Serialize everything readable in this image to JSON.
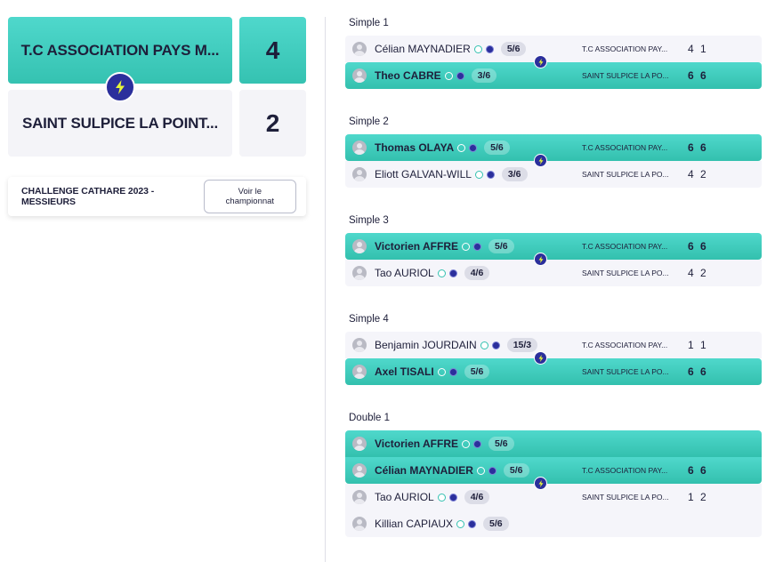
{
  "home_team": {
    "name": "T.C ASSOCIATION PAYS M...",
    "score": "4"
  },
  "away_team": {
    "name": "SAINT SULPICE LA POINT...",
    "score": "2"
  },
  "championship": {
    "title": "CHALLENGE CATHARE 2023 - MESSIEURS",
    "button_label": "Voir le championnat"
  },
  "colors": {
    "accent": "#35c2b1",
    "badge": "#2b2f9c",
    "neutral": "#f5f5fa"
  },
  "matches": [
    {
      "label": "Simple 1",
      "rows": [
        {
          "name": "Célian MAYNADIER",
          "rank": "5/6",
          "club": "T.C ASSOCIATION PAY...",
          "sets": "4 1",
          "win": false
        },
        {
          "name": "Theo CABRE",
          "rank": "3/6",
          "club": "SAINT SULPICE LA PO...",
          "sets": "6 6",
          "win": true
        }
      ]
    },
    {
      "label": "Simple 2",
      "rows": [
        {
          "name": "Thomas OLAYA",
          "rank": "5/6",
          "club": "T.C ASSOCIATION PAY...",
          "sets": "6 6",
          "win": true
        },
        {
          "name": "Eliott GALVAN-WILL",
          "rank": "3/6",
          "club": "SAINT SULPICE LA PO...",
          "sets": "4 2",
          "win": false
        }
      ]
    },
    {
      "label": "Simple 3",
      "rows": [
        {
          "name": "Victorien AFFRE",
          "rank": "5/6",
          "club": "T.C ASSOCIATION PAY...",
          "sets": "6 6",
          "win": true
        },
        {
          "name": "Tao AURIOL",
          "rank": "4/6",
          "club": "SAINT SULPICE LA PO...",
          "sets": "4 2",
          "win": false
        }
      ]
    },
    {
      "label": "Simple 4",
      "rows": [
        {
          "name": "Benjamin JOURDAIN",
          "rank": "15/3",
          "club": "T.C ASSOCIATION PAY...",
          "sets": "1 1",
          "win": false
        },
        {
          "name": "Axel TISALI",
          "rank": "5/6",
          "club": "SAINT SULPICE LA PO...",
          "sets": "6 6",
          "win": true
        }
      ]
    },
    {
      "label": "Double 1",
      "rows": [
        {
          "name": "Victorien AFFRE",
          "rank": "5/6",
          "club": "",
          "sets": "",
          "win": true
        },
        {
          "name": "Célian MAYNADIER",
          "rank": "5/6",
          "club": "T.C ASSOCIATION PAY...",
          "sets": "6 6",
          "win": true
        },
        {
          "name": "Tao AURIOL",
          "rank": "4/6",
          "club": "SAINT SULPICE LA PO...",
          "sets": "1 2",
          "win": false
        },
        {
          "name": "Killian CAPIAUX",
          "rank": "5/6",
          "club": "",
          "sets": "",
          "win": false
        }
      ]
    }
  ]
}
